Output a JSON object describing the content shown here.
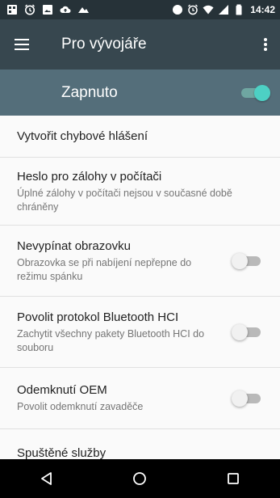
{
  "status_bar": {
    "left_icons": [
      "bbm-icon",
      "clock-app-icon",
      "gallery-icon",
      "cloud-upload-icon",
      "cloud-icon"
    ],
    "right_icons": [
      "bbm-dot-icon",
      "alarm-icon",
      "wifi-icon",
      "signal-icon",
      "battery-icon"
    ],
    "time": "14:42"
  },
  "app_bar": {
    "title": "Pro vývojáře",
    "menu_icon": "hamburger-menu-icon",
    "more_icon": "more-vert-icon"
  },
  "master_switch": {
    "label": "Zapnuto",
    "checked": true
  },
  "items": [
    {
      "title": "Vytvořit chybové hlášení"
    },
    {
      "title": "Heslo pro zálohy v počítači",
      "subtitle": "Úplné zálohy v počítači nejsou v současné době chráněny"
    },
    {
      "title": "Nevypínat obrazovku",
      "subtitle": "Obrazovka se při nabíjení nepřepne do režimu spánku",
      "checked": false
    },
    {
      "title": "Povolit protokol Bluetooth HCI",
      "subtitle": "Zachytit všechny pakety Bluetooth HCI do souboru",
      "checked": false
    },
    {
      "title": "Odemknutí OEM",
      "subtitle": "Povolit odemknutí zavaděče",
      "checked": false
    },
    {
      "title": "Spuštěné služby"
    }
  ],
  "nav_bar": {
    "back_icon": "back-triangle-icon",
    "home_icon": "home-circle-icon",
    "recents_icon": "recents-square-icon"
  },
  "colors": {
    "status_bar": "#263238",
    "app_bar": "#37474f",
    "master_bar": "#546e7a",
    "accent": "#4dd0c4"
  }
}
